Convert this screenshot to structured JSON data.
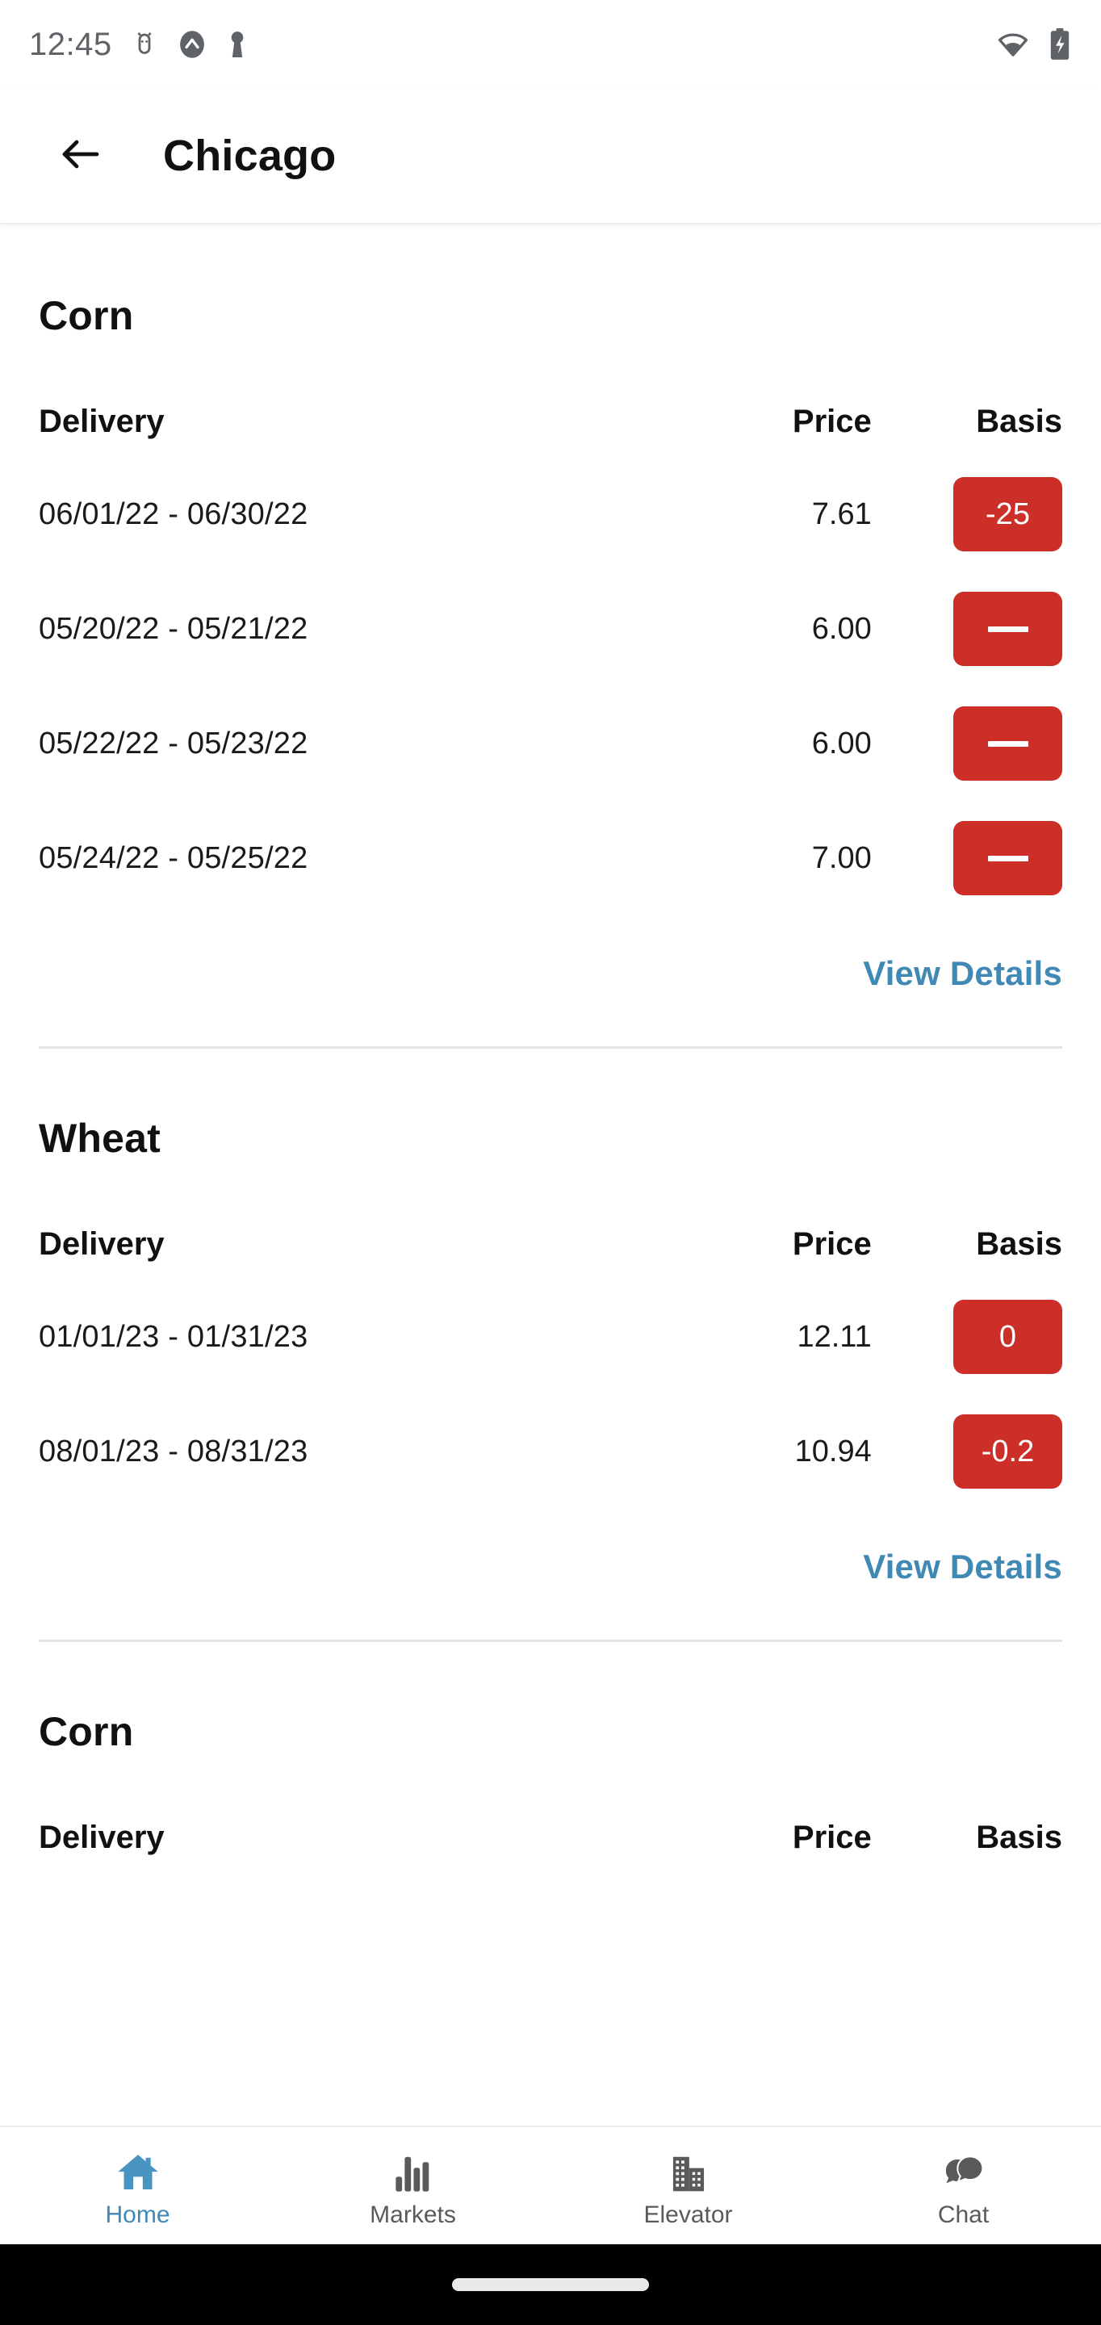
{
  "status_bar": {
    "time": "12:45",
    "left_icons": [
      "android-bug-icon",
      "circled-chevron-up-icon",
      "key-icon"
    ],
    "right_icons": [
      "wifi-icon",
      "battery-charging-icon"
    ]
  },
  "app_bar": {
    "back_icon": "back-arrow-icon",
    "title": "Chicago"
  },
  "colors": {
    "accent_blue": "#4189b5",
    "badge_red": "#cc2e28",
    "text_primary": "#111111",
    "divider": "#e4e4e4",
    "nav_inactive": "#5a5a5a"
  },
  "table_headers": {
    "delivery": "Delivery",
    "price": "Price",
    "basis": "Basis"
  },
  "view_details_label": "View Details",
  "sections": [
    {
      "title": "Corn",
      "rows": [
        {
          "delivery": "06/01/22 - 06/30/22",
          "price": "7.61",
          "basis": "-25",
          "basis_empty": false
        },
        {
          "delivery": "05/20/22 - 05/21/22",
          "price": "6.00",
          "basis": "",
          "basis_empty": true
        },
        {
          "delivery": "05/22/22 - 05/23/22",
          "price": "6.00",
          "basis": "",
          "basis_empty": true
        },
        {
          "delivery": "05/24/22 - 05/25/22",
          "price": "7.00",
          "basis": "",
          "basis_empty": true
        }
      ]
    },
    {
      "title": "Wheat",
      "rows": [
        {
          "delivery": "01/01/23 - 01/31/23",
          "price": "12.11",
          "basis": "0",
          "basis_empty": false
        },
        {
          "delivery": "08/01/23 - 08/31/23",
          "price": "10.94",
          "basis": "-0.2",
          "basis_empty": false
        }
      ]
    },
    {
      "title": "Corn",
      "rows": []
    }
  ],
  "bottom_nav": [
    {
      "label": "Home",
      "icon": "home-icon",
      "active": true
    },
    {
      "label": "Markets",
      "icon": "bar-chart-icon",
      "active": false
    },
    {
      "label": "Elevator",
      "icon": "building-icon",
      "active": false
    },
    {
      "label": "Chat",
      "icon": "chat-icon",
      "active": false
    }
  ]
}
